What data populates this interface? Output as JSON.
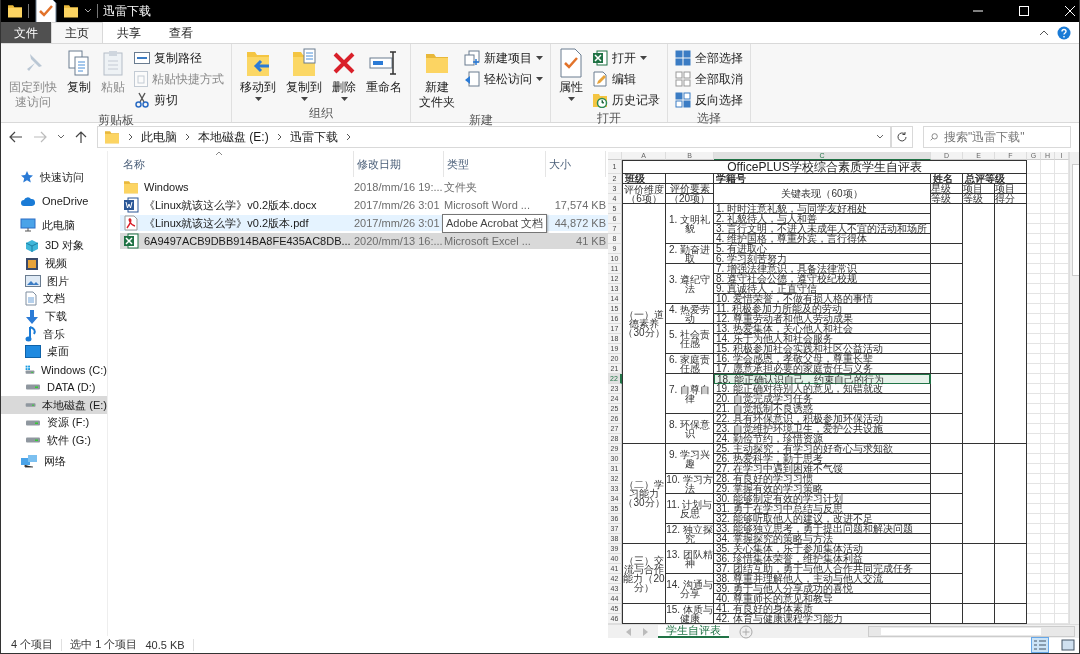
{
  "window": {
    "title": "迅雷下载"
  },
  "ribbon_tabs": [
    {
      "label": "文件",
      "kind": "file",
      "selected": false
    },
    {
      "label": "主页",
      "kind": "tab",
      "selected": true
    },
    {
      "label": "共享",
      "kind": "tab",
      "selected": false
    },
    {
      "label": "查看",
      "kind": "tab",
      "selected": false
    }
  ],
  "ribbon": {
    "groups": [
      {
        "label": "剪贴板",
        "buttons": [
          {
            "lines": [
              "固定到快",
              "速访问"
            ],
            "kind": "large",
            "disabled": true,
            "dropdown": false
          },
          {
            "label": "复制",
            "kind": "large",
            "disabled": false,
            "dropdown": false
          },
          {
            "label": "粘贴",
            "kind": "large",
            "disabled": true,
            "dropdown": false
          },
          {
            "label": "复制路径",
            "kind": "small",
            "disabled": false,
            "dropdown": false
          },
          {
            "label": "粘贴快捷方式",
            "kind": "small",
            "disabled": true,
            "dropdown": false
          },
          {
            "label": "剪切",
            "kind": "small",
            "disabled": false,
            "dropdown": false
          }
        ]
      },
      {
        "label": "组织",
        "buttons": [
          {
            "label": "移动到",
            "kind": "large",
            "disabled": false,
            "dropdown": true
          },
          {
            "label": "复制到",
            "kind": "large",
            "disabled": false,
            "dropdown": true
          },
          {
            "label": "删除",
            "kind": "large",
            "disabled": false,
            "dropdown": true
          },
          {
            "label": "重命名",
            "kind": "large",
            "disabled": false,
            "dropdown": false
          }
        ]
      },
      {
        "label": "新建",
        "buttons": [
          {
            "lines": [
              "新建",
              "文件夹"
            ],
            "kind": "large",
            "disabled": false,
            "dropdown": false
          },
          {
            "label": "新建项目",
            "kind": "small",
            "disabled": false,
            "dropdown": true
          },
          {
            "label": "轻松访问",
            "kind": "small",
            "disabled": false,
            "dropdown": true
          }
        ]
      },
      {
        "label": "打开",
        "buttons": [
          {
            "label": "属性",
            "kind": "large",
            "disabled": false,
            "dropdown": true
          },
          {
            "label": "打开",
            "kind": "small",
            "disabled": false,
            "dropdown": true
          },
          {
            "label": "编辑",
            "kind": "small",
            "disabled": false,
            "dropdown": false
          },
          {
            "label": "历史记录",
            "kind": "small",
            "disabled": false,
            "dropdown": false
          }
        ]
      },
      {
        "label": "选择",
        "buttons": [
          {
            "label": "全部选择",
            "kind": "small",
            "disabled": false,
            "dropdown": false
          },
          {
            "label": "全部取消",
            "kind": "small",
            "disabled": false,
            "dropdown": false
          },
          {
            "label": "反向选择",
            "kind": "small",
            "disabled": false,
            "dropdown": false
          }
        ]
      }
    ]
  },
  "address_bar": {
    "breadcrumbs": [
      "此电脑",
      "本地磁盘 (E:)",
      "迅雷下载"
    ]
  },
  "search": {
    "placeholder": "搜索\"迅雷下载\""
  },
  "sidebar": {
    "items": [
      {
        "label": "快速访问",
        "selected": false
      },
      {
        "label": "OneDrive",
        "selected": false
      },
      {
        "label": "此电脑",
        "selected": false,
        "children": [
          {
            "label": "3D 对象",
            "selected": false
          },
          {
            "label": "视频",
            "selected": false
          },
          {
            "label": "图片",
            "selected": false
          },
          {
            "label": "文档",
            "selected": false
          },
          {
            "label": "下载",
            "selected": false
          },
          {
            "label": "音乐",
            "selected": false
          },
          {
            "label": "桌面",
            "selected": false
          },
          {
            "label": "Windows (C:)",
            "selected": false
          },
          {
            "label": "DATA (D:)",
            "selected": false
          },
          {
            "label": "本地磁盘 (E:)",
            "selected": true
          },
          {
            "label": "资源 (F:)",
            "selected": false
          },
          {
            "label": "软件 (G:)",
            "selected": false
          }
        ]
      },
      {
        "label": "网络",
        "selected": false
      }
    ]
  },
  "file_list": {
    "columns": [
      "名称",
      "修改日期",
      "类型",
      "大小"
    ],
    "rows": [
      {
        "kind": "folder",
        "name": "Windows",
        "date": "2018/mm/16 19:...",
        "type": "文件夹",
        "selected": false,
        "hovered": false
      },
      {
        "kind": "word",
        "name": "《Linux就该这么学》v0.2版本.docx",
        "date": "2017/mm/26 3:01",
        "type": "Microsoft Word ...",
        "size": "17,574 KB",
        "selected": false,
        "hovered": false
      },
      {
        "kind": "pdf",
        "name": "《Linux就该这么学》v0.2版本.pdf",
        "date": "2017/mm/26 3:01",
        "size": "44,872 KB",
        "selected": false,
        "hovered": true
      },
      {
        "kind": "excel",
        "name": "6A9497ACB9DBB914BA8FE435AC8DB...",
        "date": "2020/mm/13 16:...",
        "type": "Microsoft Excel ...",
        "size": "41 KB",
        "selected": true,
        "hovered": false
      }
    ],
    "tooltip": "Adobe Acrobat 文档"
  },
  "preview": {
    "sheet": {
      "columns": [
        {
          "label": "A",
          "selected": false
        },
        {
          "label": "B",
          "selected": false
        },
        {
          "label": "C",
          "selected": true
        },
        {
          "label": "D",
          "selected": false
        },
        {
          "label": "E",
          "selected": false
        },
        {
          "label": "F",
          "selected": false
        },
        {
          "label": "G",
          "selected": false
        },
        {
          "label": "H",
          "selected": false
        },
        {
          "label": "I",
          "selected": false
        }
      ],
      "row_numbers": [
        "1",
        "2",
        "3",
        "4",
        "5",
        "6",
        "7",
        "8",
        "9",
        "10",
        "11",
        "12",
        "13",
        "14",
        "15",
        "16",
        "17",
        "18",
        "19",
        "20",
        "21",
        "22",
        "23",
        "24",
        "25",
        "26",
        "27",
        "28",
        "29",
        "30",
        "31",
        "32",
        "33",
        "34",
        "35",
        "36",
        "37",
        "38",
        "39",
        "40",
        "41",
        "42",
        "43",
        "44",
        "45",
        "46"
      ],
      "title": "OfficePLUS学校综合素质学生自评表",
      "class_label": "班级",
      "student_id_label": "学籍号",
      "name_label": "姓名",
      "grade_label": "总评等级",
      "dimension_header": "评价维度（6项）",
      "element_header": "评价要素",
      "element_count": "（20项）",
      "key_header": "关键表现（60项）",
      "row3": [
        "星级",
        "项目",
        "项目"
      ],
      "row4": [
        "等级",
        "等级",
        "得分"
      ],
      "sections": [
        {
          "dimension": "（一）道德素养（30分）",
          "groups": [
            {
              "element": "1. 文明礼貌",
              "items": [
                {
                  "text": "1. 时时注意礼貌，与同学友好相处",
                  "selected": false
                },
                {
                  "text": "2. 礼貌待人，与人和善",
                  "selected": false
                },
                {
                  "text": "3. 言行文明，不进入未成年人不宜的活动和场所",
                  "selected": false
                },
                {
                  "text": "4. 维护国格，尊重外宾，言行得体",
                  "selected": false
                }
              ]
            },
            {
              "element": "2. 勤奋进取",
              "items": [
                {
                  "text": "5. 有进取心",
                  "selected": false
                },
                {
                  "text": "6. 学习刻苦努力",
                  "selected": false
                }
              ]
            },
            {
              "element": "3. 遵纪守法",
              "items": [
                {
                  "text": "7. 增强法律意识，具备法律常识",
                  "selected": false
                },
                {
                  "text": "8. 遵守社会公德，遵守校纪校规",
                  "selected": false
                },
                {
                  "text": "9. 真诚待人，正直守信",
                  "selected": false
                },
                {
                  "text": "10. 爱惜荣誉，不做有损人格的事情",
                  "selected": false
                }
              ]
            },
            {
              "element": "4. 热爱劳动",
              "items": [
                {
                  "text": "11. 积极参加力所能及的劳动",
                  "selected": false
                },
                {
                  "text": "12. 尊重劳动者和他人劳动成果",
                  "selected": false
                }
              ]
            },
            {
              "element": "5. 社会责任感",
              "items": [
                {
                  "text": "13. 热爱集体，关心他人和社会",
                  "selected": false
                },
                {
                  "text": "14. 乐于为他人和社会服务",
                  "selected": false
                },
                {
                  "text": "15. 积极参加社会实践和社区公益活动",
                  "selected": false
                }
              ]
            },
            {
              "element": "6. 家庭责任感",
              "items": [
                {
                  "text": "16. 学会感恩，孝敬父母，尊重长辈",
                  "selected": false
                },
                {
                  "text": "17. 愿意承担必要的家庭责任与义务",
                  "selected": false
                }
              ]
            },
            {
              "element": "7. 自尊自律",
              "items": [
                {
                  "text": "18. 能正确认识自己，约束自己的行为",
                  "selected": true
                },
                {
                  "text": "19. 能正确对待别人的意见，知错就改",
                  "selected": false
                },
                {
                  "text": "20. 自觉完成学习任务",
                  "selected": false
                },
                {
                  "text": "21. 自觉抵制不良诱惑",
                  "selected": false
                }
              ]
            },
            {
              "element": "8. 环保意识",
              "items": [
                {
                  "text": "22. 具有环保意识，积极参加环保活动",
                  "selected": false
                },
                {
                  "text": "23. 自觉维护环境卫生，爱护公共设施",
                  "selected": false
                },
                {
                  "text": "24. 勤俭节约，珍惜资源",
                  "selected": false
                }
              ]
            }
          ]
        },
        {
          "dimension": "（二）学习能力（30分）",
          "groups": [
            {
              "element": "9. 学习兴趣",
              "items": [
                {
                  "text": "25. 主动探究，有学习的好奇心与求知欲",
                  "selected": false
                },
                {
                  "text": "26. 热爱科学，勤于思考",
                  "selected": false
                },
                {
                  "text": "27. 在学习中遇到困难不气馁",
                  "selected": false
                }
              ]
            },
            {
              "element": "10. 学习方法",
              "items": [
                {
                  "text": "28. 有良好的学习习惯",
                  "selected": false
                },
                {
                  "text": "29. 掌握有效的学习策略",
                  "selected": false
                }
              ]
            },
            {
              "element": "11. 计划与反思",
              "items": [
                {
                  "text": "30. 能够制定有效的学习计划",
                  "selected": false
                },
                {
                  "text": "31. 勇于在学习中总结与反思",
                  "selected": false
                },
                {
                  "text": "32. 能够听取他人的建议，改进不足",
                  "selected": false
                }
              ]
            },
            {
              "element": "12. 独立探究",
              "items": [
                {
                  "text": "33. 能够独立思考，勇于提出问题和解决问题",
                  "selected": false
                },
                {
                  "text": "34. 掌握探究的策略与方法",
                  "selected": false
                }
              ]
            }
          ]
        },
        {
          "dimension": "（三）交流与合作能力（20分）",
          "groups": [
            {
              "element": "13. 团队精神",
              "items": [
                {
                  "text": "35. 关心集体，乐于参加集体活动",
                  "selected": false
                },
                {
                  "text": "36. 珍惜集体荣誉，维护集体利益",
                  "selected": false
                },
                {
                  "text": "37. 团结互助，勇于与他人合作共同完成任务",
                  "selected": false
                }
              ]
            },
            {
              "element": "14. 沟通与分享",
              "items": [
                {
                  "text": "38. 尊重并理解他人，主动与他人交流",
                  "selected": false
                },
                {
                  "text": "39. 勇于与他人分享成功的喜悦",
                  "selected": false
                },
                {
                  "text": "40. 尊重师长的意见和教导",
                  "selected": false
                }
              ]
            }
          ]
        },
        {
          "groups": [
            {
              "element": "15. 体质与健康",
              "items": [
                {
                  "text": "41. 有良好的身体素质",
                  "selected": false
                },
                {
                  "text": "42. 体育与健康课程学习能力",
                  "selected": false
                }
              ]
            }
          ]
        }
      ],
      "tabs": [
        {
          "label": "学生自评表",
          "selected": true
        }
      ]
    }
  },
  "status_bar": {
    "item_count": "4 个项目",
    "selection": "选中 1 个项目",
    "selection_size": "40.5 KB",
    "views": [
      {
        "selected": true
      },
      {
        "selected": false
      }
    ]
  }
}
